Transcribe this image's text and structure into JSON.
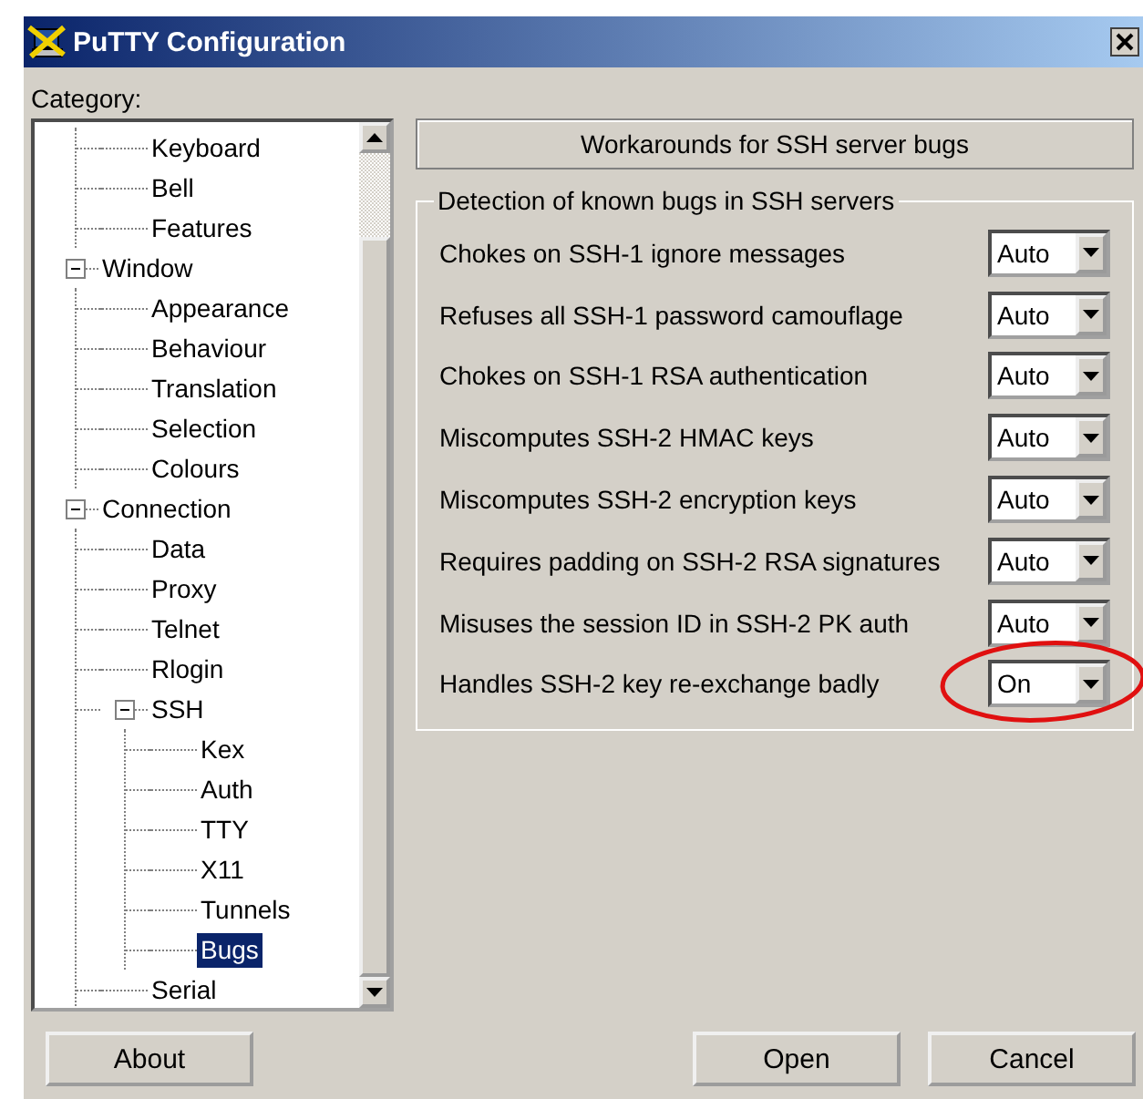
{
  "window": {
    "title": "PuTTY Configuration"
  },
  "category_label": "Category:",
  "tree": [
    {
      "children": [
        {
          "label": "Keyboard",
          "selected": false
        },
        {
          "label": "Bell",
          "selected": false
        },
        {
          "label": "Features",
          "selected": false
        }
      ]
    },
    {
      "label": "Window",
      "selected": false,
      "expanded": true,
      "children": [
        {
          "label": "Appearance",
          "selected": false
        },
        {
          "label": "Behaviour",
          "selected": false
        },
        {
          "label": "Translation",
          "selected": false
        },
        {
          "label": "Selection",
          "selected": false
        },
        {
          "label": "Colours",
          "selected": false
        }
      ]
    },
    {
      "label": "Connection",
      "selected": false,
      "expanded": true,
      "children": [
        {
          "label": "Data",
          "selected": false
        },
        {
          "label": "Proxy",
          "selected": false
        },
        {
          "label": "Telnet",
          "selected": false
        },
        {
          "label": "Rlogin",
          "selected": false
        },
        {
          "label": "SSH",
          "selected": false,
          "expanded": true,
          "children": [
            {
              "label": "Kex",
              "selected": false
            },
            {
              "label": "Auth",
              "selected": false
            },
            {
              "label": "TTY",
              "selected": false
            },
            {
              "label": "X11",
              "selected": false
            },
            {
              "label": "Tunnels",
              "selected": false
            },
            {
              "label": "Bugs",
              "selected": true
            }
          ]
        },
        {
          "label": "Serial",
          "selected": false
        }
      ]
    }
  ],
  "panel_title": "Workarounds for SSH server bugs",
  "group": {
    "title": "Detection of known bugs in SSH servers",
    "rows": [
      {
        "label": "Chokes on SSH-1 ignore messages",
        "value": "Auto",
        "highlighted": false
      },
      {
        "label": "Refuses all SSH-1 password camouflage",
        "value": "Auto",
        "highlighted": false
      },
      {
        "label": "Chokes on SSH-1 RSA authentication",
        "value": "Auto",
        "highlighted": false
      },
      {
        "label": "Miscomputes SSH-2 HMAC keys",
        "value": "Auto",
        "highlighted": false
      },
      {
        "label": "Miscomputes SSH-2 encryption keys",
        "value": "Auto",
        "highlighted": false
      },
      {
        "label": "Requires padding on SSH-2 RSA signatures",
        "value": "Auto",
        "highlighted": false
      },
      {
        "label": "Misuses the session ID in SSH-2 PK auth",
        "value": "Auto",
        "highlighted": false
      },
      {
        "label": "Handles SSH-2 key re-exchange badly",
        "value": "On",
        "highlighted": true
      }
    ]
  },
  "buttons": {
    "left": [
      "About"
    ],
    "right": [
      "Open",
      "Cancel"
    ]
  }
}
